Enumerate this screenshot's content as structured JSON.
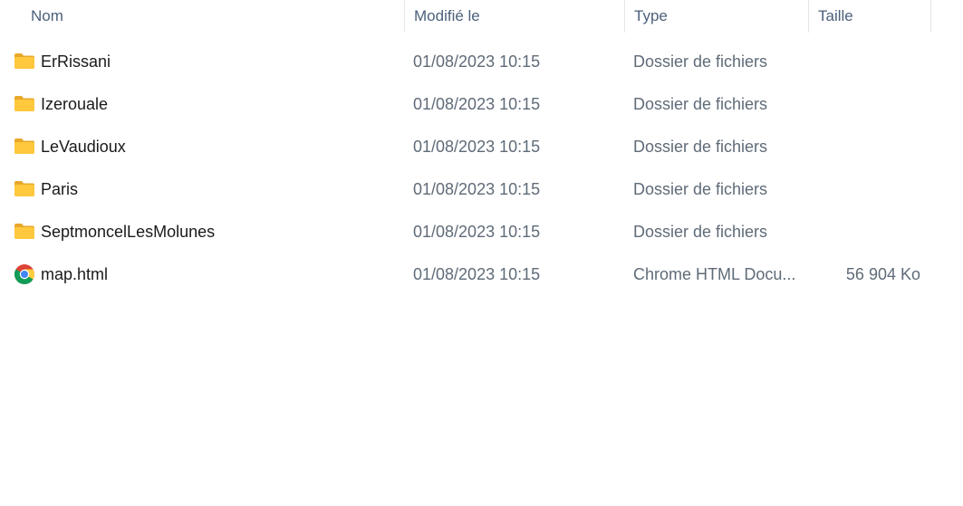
{
  "columns": {
    "name": "Nom",
    "modified": "Modifié le",
    "type": "Type",
    "size": "Taille"
  },
  "sort_indicator": "⌃",
  "files": [
    {
      "name": "ErRissani",
      "modified": "01/08/2023 10:15",
      "type": "Dossier de fichiers",
      "size": "",
      "icon": "folder-icon"
    },
    {
      "name": "Izerouale",
      "modified": "01/08/2023 10:15",
      "type": "Dossier de fichiers",
      "size": "",
      "icon": "folder-icon"
    },
    {
      "name": "LeVaudioux",
      "modified": "01/08/2023 10:15",
      "type": "Dossier de fichiers",
      "size": "",
      "icon": "folder-icon"
    },
    {
      "name": "Paris",
      "modified": "01/08/2023 10:15",
      "type": "Dossier de fichiers",
      "size": "",
      "icon": "folder-icon"
    },
    {
      "name": "SeptmoncelLesMolunes",
      "modified": "01/08/2023 10:15",
      "type": "Dossier de fichiers",
      "size": "",
      "icon": "folder-icon"
    },
    {
      "name": "map.html",
      "modified": "01/08/2023 10:15",
      "type": "Chrome HTML Docu...",
      "size": "56 904 Ko",
      "icon": "chrome-icon"
    }
  ],
  "colors": {
    "folder_yellow": "#ffc83d",
    "folder_dark": "#e8a82a",
    "header_text": "#4c607a"
  }
}
